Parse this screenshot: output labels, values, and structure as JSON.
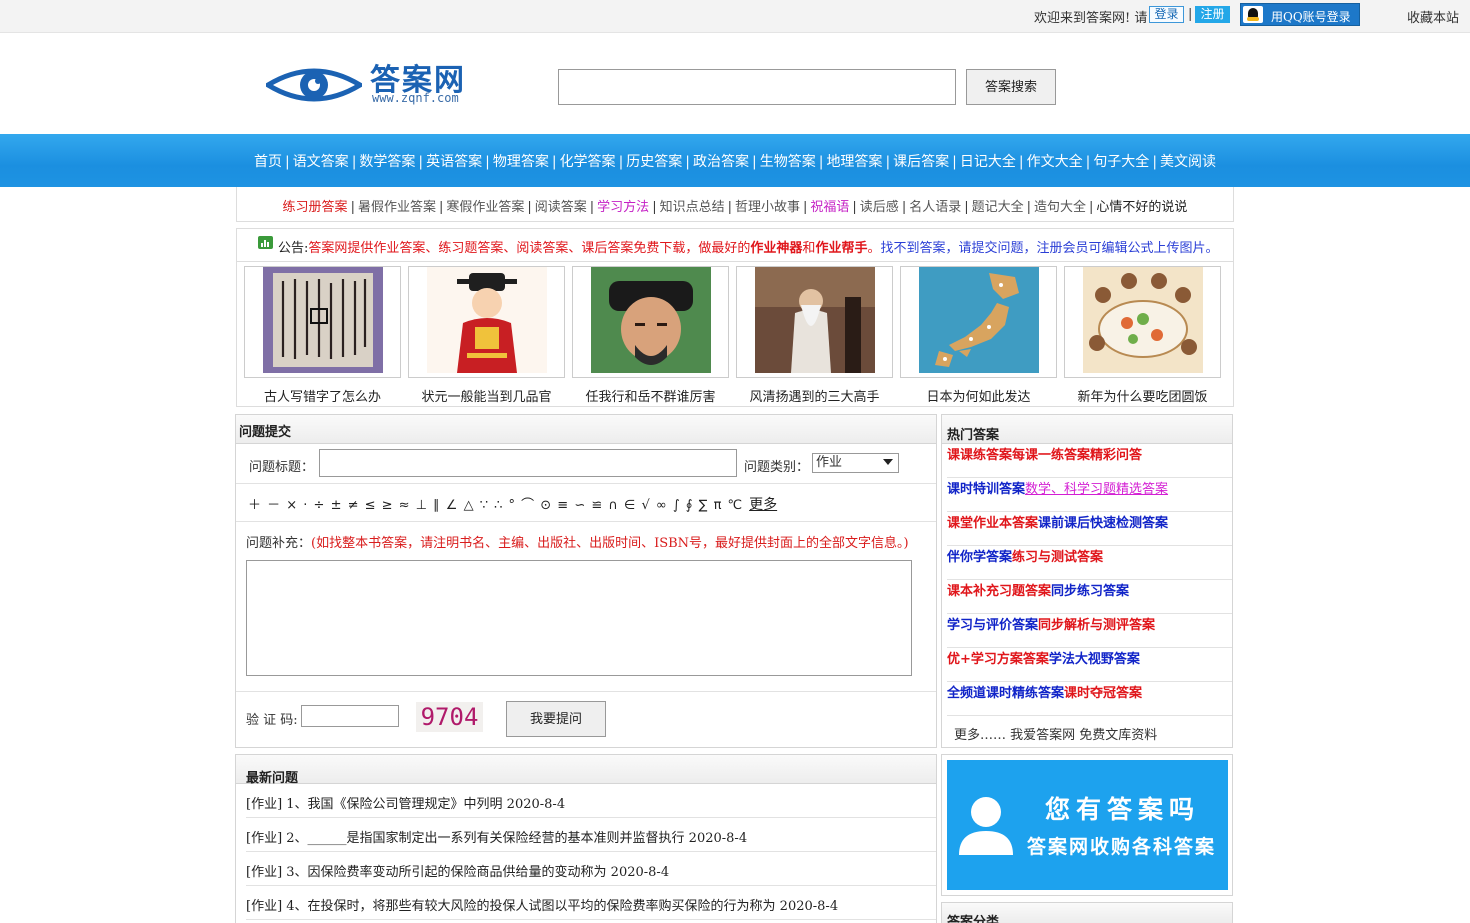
{
  "topbar": {
    "welcome": "欢迎来到答案网! 请",
    "login": "登录",
    "sep": "|",
    "register": "注册",
    "qq_login": "用QQ账号登录",
    "favorite": "收藏本站"
  },
  "header": {
    "logo_text": "答案网",
    "logo_url": "www.zqnf.com",
    "search_button": "答案搜索",
    "search_value": ""
  },
  "nav": {
    "items": [
      {
        "label": "首页",
        "style": "normal"
      },
      {
        "label": "语文答案",
        "style": "normal"
      },
      {
        "label": "数学答案",
        "style": "normal"
      },
      {
        "label": "英语答案",
        "style": "normal"
      },
      {
        "label": "物理答案",
        "style": "normal"
      },
      {
        "label": "化学答案",
        "style": "normal"
      },
      {
        "label": "历史答案",
        "style": "normal"
      },
      {
        "label": "政治答案",
        "style": "normal"
      },
      {
        "label": "生物答案",
        "style": "normal"
      },
      {
        "label": "地理答案",
        "style": "normal"
      },
      {
        "label": "课后答案",
        "style": "normal"
      },
      {
        "label": "日记大全",
        "style": "yellow"
      },
      {
        "label": "作文大全",
        "style": "yellow"
      },
      {
        "label": "句子大全",
        "style": "red"
      },
      {
        "label": "美文阅读",
        "style": "normal"
      }
    ]
  },
  "subnav": {
    "items": [
      {
        "label": "练习册答案",
        "style": "red"
      },
      {
        "label": "暑假作业答案",
        "style": "normal"
      },
      {
        "label": "寒假作业答案",
        "style": "normal"
      },
      {
        "label": "阅读答案",
        "style": "normal"
      },
      {
        "label": "学习方法",
        "style": "pink"
      },
      {
        "label": "知识点总结",
        "style": "normal"
      },
      {
        "label": "哲理小故事",
        "style": "normal"
      },
      {
        "label": "祝福语",
        "style": "pink"
      },
      {
        "label": "读后感",
        "style": "normal"
      },
      {
        "label": "名人语录",
        "style": "normal"
      },
      {
        "label": "题记大全",
        "style": "normal"
      },
      {
        "label": "造句大全",
        "style": "normal"
      },
      {
        "label": "心情不好的说说",
        "style": "black"
      }
    ]
  },
  "notice": {
    "label": "公告:",
    "part1": "答案网提供作业答案、练习题答案、阅读答案、课后答案免费下载，做最好的",
    "bold1": "作业神器",
    "and": "和",
    "bold2": "作业帮手",
    "period": "。",
    "part2": "找不到答案，请提交问题，注册会员可编辑公式上传图片。"
  },
  "pictures": [
    {
      "caption": "古人写错字了怎么办",
      "image": "calligraphy"
    },
    {
      "caption": "状元一般能当到几品官",
      "image": "official-cartoon"
    },
    {
      "caption": "任我行和岳不群谁厉害",
      "image": "actor-portrait"
    },
    {
      "caption": "风清扬遇到的三大高手",
      "image": "elder-swordsman"
    },
    {
      "caption": "日本为何如此发达",
      "image": "japan-map"
    },
    {
      "caption": "新年为什么要吃团圆饭",
      "image": "family-dinner"
    }
  ],
  "question_form": {
    "header": "问题提交",
    "title_label": "问题标题：",
    "title_value": "",
    "category_label": "问题类别：",
    "category_selected": "作业",
    "symbols": "＋ － × · ÷ ± ≠ ≤ ≥ ≈ ⊥ ∥ ∠ △ ∵ ∴ ° ⌒ ⊙ ≡ ∽ ≌ ∩ ∈ √ ∞ ∫ ∮ ∑ π ℃",
    "more": "更多",
    "supplement_label": "问题补充：",
    "supplement_hint": "(如找整本书答案，请注明书名、主编、出版社、出版时间、ISBN号，最好提供封面上的全部文字信息。)",
    "code_label": "验 证 码:",
    "code_value": "",
    "captcha": "9704",
    "submit": "我要提问"
  },
  "hot": {
    "header": "热门答案",
    "rows": [
      [
        {
          "label": "课课练答案",
          "style": "red"
        },
        {
          "label": "每课一练答案",
          "style": "red"
        },
        {
          "label": "精彩问答",
          "style": "red"
        }
      ],
      [
        {
          "label": "课时特训答案",
          "style": "blue"
        },
        {
          "label": "数学、科学习题精选答案",
          "style": "pink"
        }
      ],
      [
        {
          "label": "课堂作业本答案",
          "style": "red"
        },
        {
          "label": "课前课后快速检测答案",
          "style": "blue"
        }
      ],
      [
        {
          "label": "伴你学答案",
          "style": "blue"
        },
        {
          "label": "练习与测试答案",
          "style": "red"
        }
      ],
      [
        {
          "label": "课本补充习题答案",
          "style": "red"
        },
        {
          "label": "同步练习答案",
          "style": "blue"
        }
      ],
      [
        {
          "label": "学习与评价答案",
          "style": "blue"
        },
        {
          "label": "同步解析与测评答案",
          "style": "red"
        }
      ],
      [
        {
          "label": "优+学习方案答案",
          "style": "red"
        },
        {
          "label": "学法大视野答案",
          "style": "blue"
        }
      ],
      [
        {
          "label": "全频道课时精练答案",
          "style": "blue"
        },
        {
          "label": "课时夺冠答案",
          "style": "red"
        }
      ]
    ],
    "footer": "更多…… 我爱答案网 免费文库资料"
  },
  "latest": {
    "header": "最新问题",
    "items": [
      "[作业] 1、我国《保险公司管理规定》中列明  2020-8-4",
      "[作业] 2、______是指国家制定出一系列有关保险经营的基本准则并监督执行  2020-8-4",
      "[作业] 3、因保险费率变动所引起的保险商品供给量的变动称为  2020-8-4",
      "[作业] 4、在投保时，将那些有较大风险的投保人试图以平均的保险费率购买保险的行为称为  2020-8-4"
    ]
  },
  "ad": {
    "line1": "您有答案吗",
    "line2": "答案网收购各科答案"
  },
  "category": {
    "header": "答案分类"
  },
  "colors": {
    "nav_blue": "#1b8fe0",
    "accent_red": "#e0161b",
    "accent_blue": "#1124c8",
    "accent_pink": "#d31ed3",
    "nav_yellow": "#ffe100"
  }
}
